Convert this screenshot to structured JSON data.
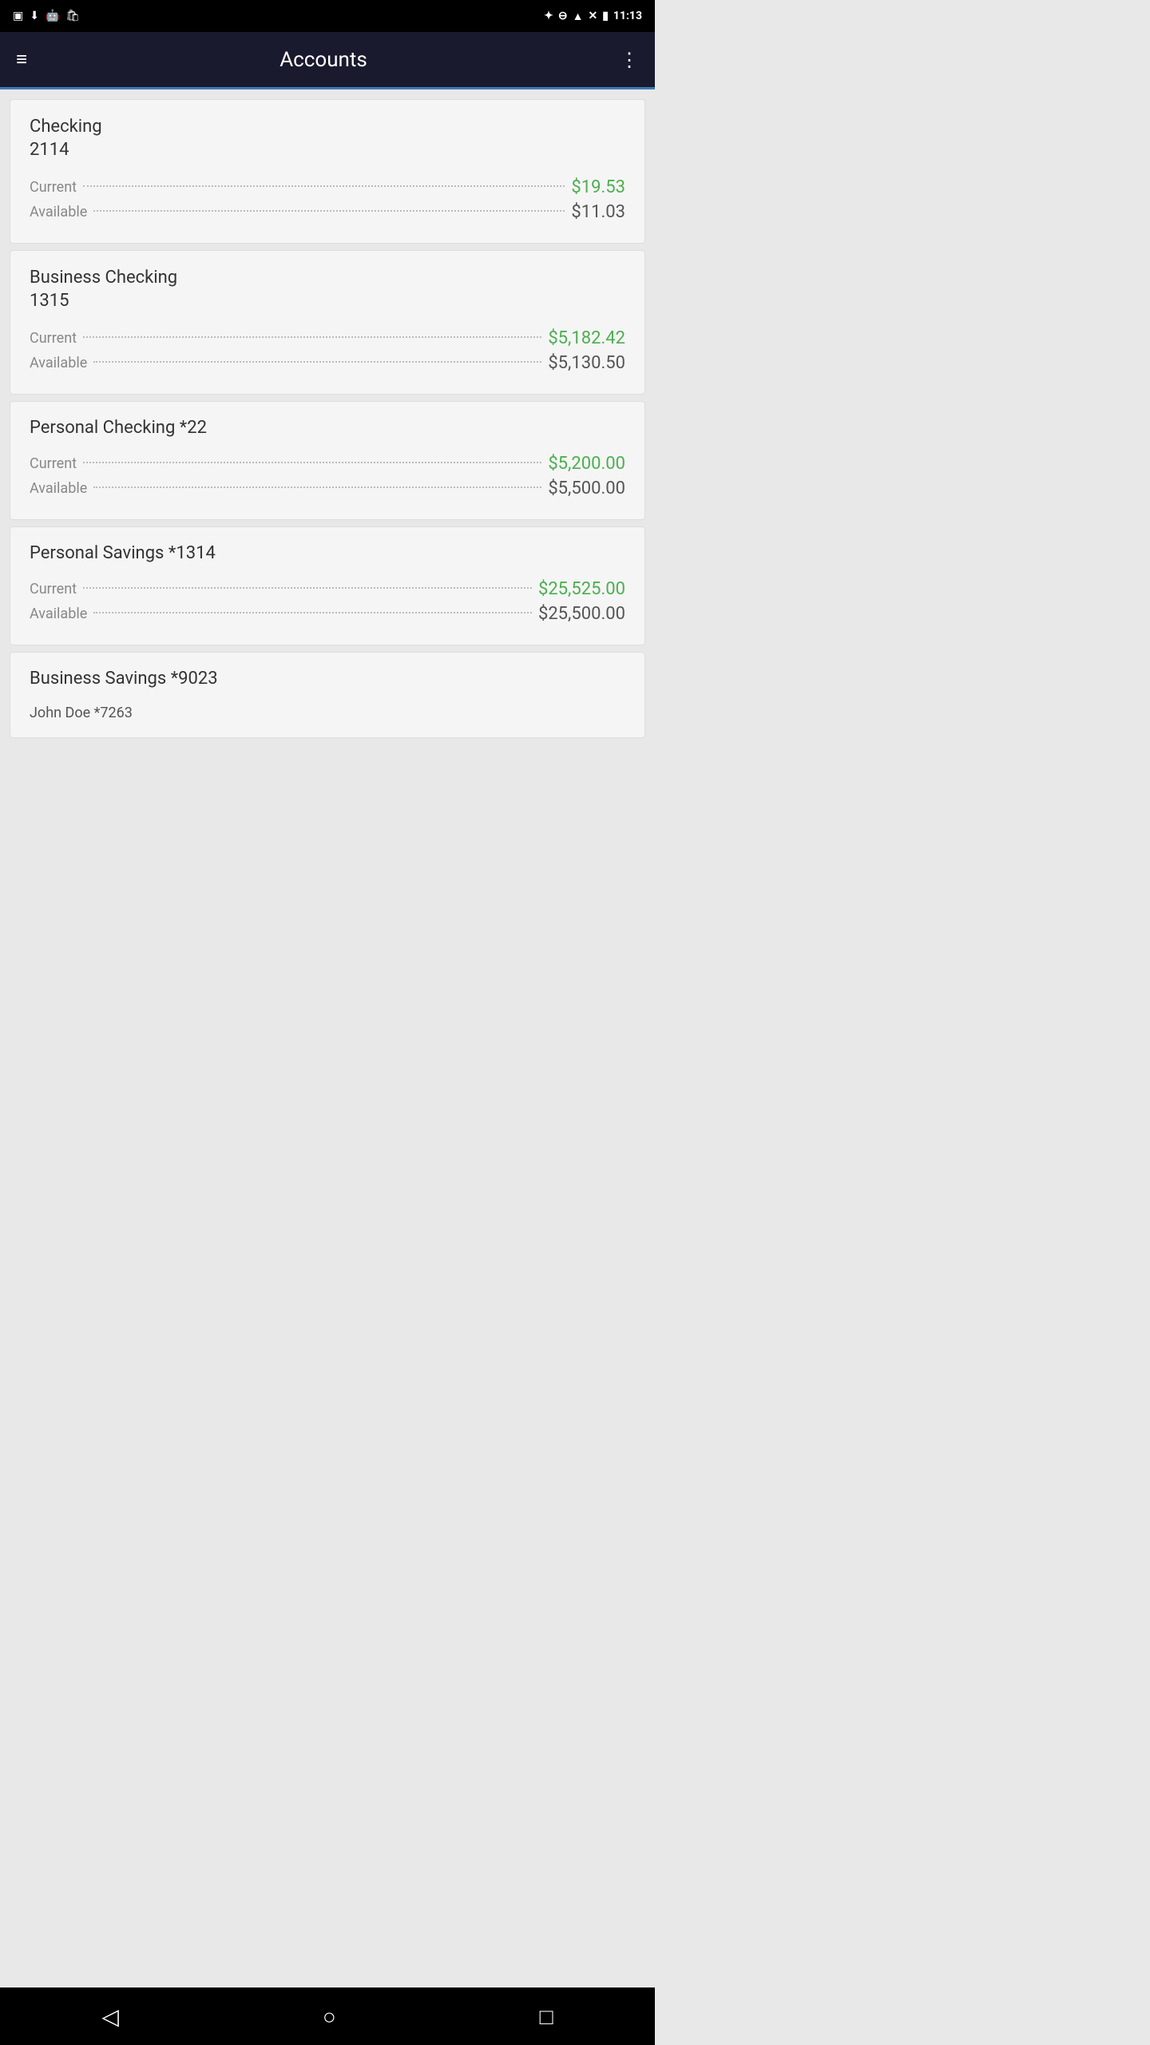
{
  "statusBar": {
    "time": "11:13",
    "icons": [
      "bluetooth",
      "minus-circle",
      "wifi",
      "sim-off",
      "battery"
    ]
  },
  "topBar": {
    "title": "Accounts",
    "menuIcon": "≡",
    "moreIcon": "⋮"
  },
  "accounts": [
    {
      "name": "Checking",
      "number": "2114",
      "current_label": "Current",
      "current_value": "$19.53",
      "available_label": "Available",
      "available_value": "$11.03",
      "single_line": false
    },
    {
      "name": "Business Checking",
      "number": "1315",
      "current_label": "Current",
      "current_value": "$5,182.42",
      "available_label": "Available",
      "available_value": "$5,130.50",
      "single_line": false
    },
    {
      "name": "Personal Checking *22",
      "number": "",
      "current_label": "Current",
      "current_value": "$5,200.00",
      "available_label": "Available",
      "available_value": "$5,500.00",
      "single_line": true
    },
    {
      "name": "Personal Savings *1314",
      "number": "",
      "current_label": "Current",
      "current_value": "$25,525.00",
      "available_label": "Available",
      "available_value": "$25,500.00",
      "single_line": true
    },
    {
      "name": "Business Savings *9023",
      "sub_label": "John Doe *7263",
      "number": "",
      "current_label": "",
      "current_value": "",
      "available_label": "",
      "available_value": "",
      "single_line": true,
      "partial": true
    }
  ],
  "bottomNav": {
    "back": "◁",
    "home": "○",
    "recents": "□"
  }
}
